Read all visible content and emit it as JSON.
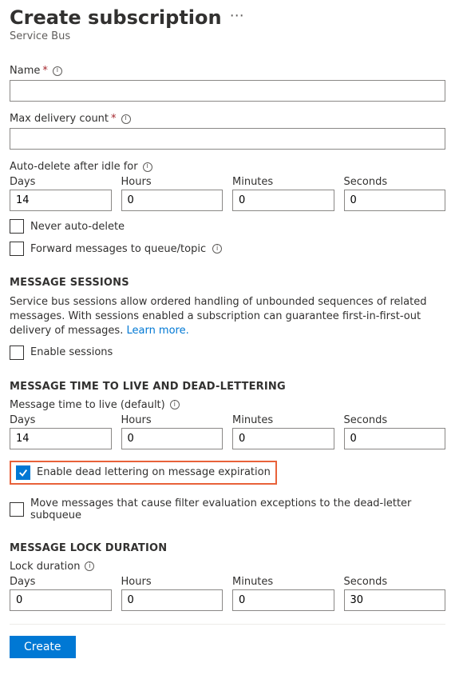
{
  "header": {
    "title": "Create subscription",
    "subtitle": "Service Bus"
  },
  "fields": {
    "name_label": "Name",
    "name_value": "",
    "max_delivery_label": "Max delivery count",
    "max_delivery_value": "",
    "auto_delete_label": "Auto-delete after idle for",
    "forward_label": "Forward messages to queue/topic"
  },
  "time_labels": {
    "days": "Days",
    "hours": "Hours",
    "minutes": "Minutes",
    "seconds": "Seconds"
  },
  "auto_delete": {
    "days": "14",
    "hours": "0",
    "minutes": "0",
    "seconds": "0",
    "never_label": "Never auto-delete"
  },
  "sessions": {
    "heading": "MESSAGE SESSIONS",
    "desc": "Service bus sessions allow ordered handling of unbounded sequences of related messages. With sessions enabled a subscription can guarantee first-in-first-out delivery of messages. ",
    "learn_more": "Learn more.",
    "enable_label": "Enable sessions"
  },
  "ttl": {
    "heading": "MESSAGE TIME TO LIVE AND DEAD-LETTERING",
    "label": "Message time to live (default)",
    "days": "14",
    "hours": "0",
    "minutes": "0",
    "seconds": "0",
    "dead_letter_label": "Enable dead lettering on message expiration",
    "move_exceptions_label": "Move messages that cause filter evaluation exceptions to the dead-letter subqueue"
  },
  "lock": {
    "heading": "MESSAGE LOCK DURATION",
    "label": "Lock duration",
    "days": "0",
    "hours": "0",
    "minutes": "0",
    "seconds": "30"
  },
  "footer": {
    "create_label": "Create"
  }
}
